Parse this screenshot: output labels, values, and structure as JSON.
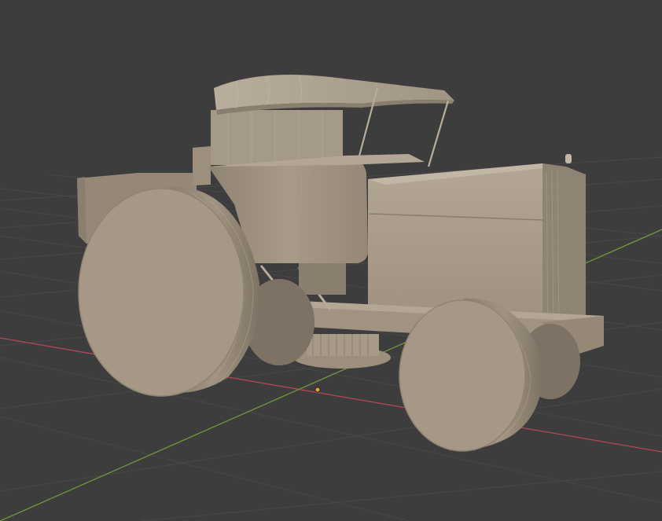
{
  "viewport": {
    "background_color": "#3d3d3d",
    "grid_color": "#484848",
    "x_axis_color": "#b3475a",
    "y_axis_color": "#6f9a3a",
    "origin_marker_color": "#f0a030"
  },
  "scene": {
    "model_color": "#a89a88",
    "model_shadow_color": "#7e7264",
    "model_highlight_color": "#c2b6a6"
  }
}
